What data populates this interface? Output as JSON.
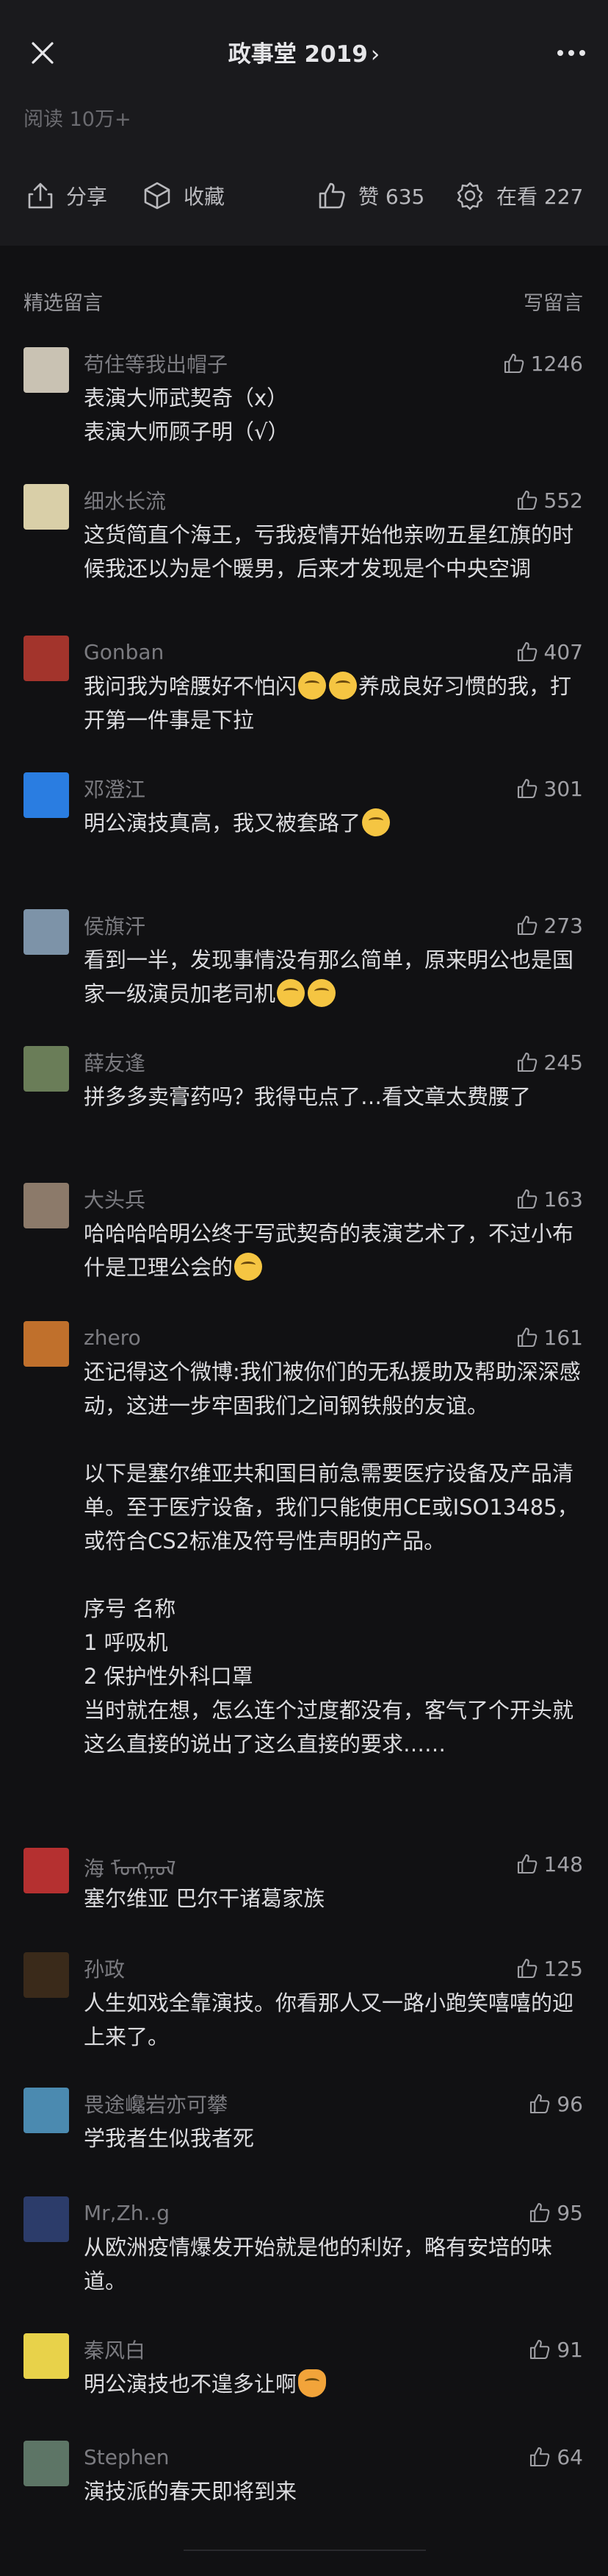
{
  "nav": {
    "title": "政事堂 2019",
    "chevron": "›"
  },
  "article": {
    "read_count": "阅读 10万+"
  },
  "actions": {
    "share": "分享",
    "favorite": "收藏",
    "like": "赞 635",
    "watching": "在看 227"
  },
  "section": {
    "title": "精选留言",
    "write": "写留言"
  },
  "colors": {
    "background": "#111113",
    "header": "#1a1a1d",
    "nickname": "#7b7b80",
    "text": "#dcdcdf"
  },
  "comments": [
    {
      "nick": "苟住等我出帽子",
      "likes": "1246",
      "text": "表演大师武契奇（x）\n表演大师顾子明（√）",
      "avatar": "#c9c2b3"
    },
    {
      "nick": "细水长流",
      "likes": "552",
      "text": "这货简直个海王，亏我疫情开始他亲吻五星红旗的时候我还以为是个暖男，后来才发现是个中央空调",
      "avatar": "#d9cfa8"
    },
    {
      "nick": "Gonban",
      "likes": "407",
      "text": "我问我为啥腰好不怕闪",
      "text_after": "养成良好习惯的我，打开第一件事是下拉",
      "avatar": "#a3342c"
    },
    {
      "nick": "邓澄江",
      "likes": "301",
      "text": "明公演技真高，我又被套路了",
      "avatar": "#2a7de1"
    },
    {
      "nick": "侯旗汗",
      "likes": "273",
      "text": "看到一半，发现事情没有那么简单，原来明公也是国家一级演员加老司机",
      "avatar": "#7d93a8"
    },
    {
      "nick": "薛友逢",
      "likes": "245",
      "text": "拼多多卖膏药吗？我得屯点了…看文章太费腰了",
      "avatar": "#6a7d58"
    },
    {
      "nick": "大头兵",
      "likes": "163",
      "text": "哈哈哈哈明公终于写武契奇的表演艺术了，不过小布什是卫理公会的",
      "avatar": "#8c7a6a"
    },
    {
      "nick": "zhero",
      "likes": "161",
      "text": "还记得这个微博:我们被你们的无私援助及帮助深深感动，这进一步牢固我们之间钢铁般的友谊。\n\n以下是塞尔维亚共和国目前急需要医疗设备及产品清单。至于医疗设备，我们只能使用CE或ISO13485，或符合CS2标准及符号性声明的产品。\n\n序号 名称\n1 呼吸机\n2 保护性外科口罩\n当时就在想，怎么连个过度都没有，客气了个开头就这么直接的说出了这么直接的要求……",
      "avatar": "#c0702c"
    },
    {
      "nick": "海 ᠮᠣᠩᠭᠣᠯ",
      "likes": "148",
      "text": "塞尔维亚 巴尔干诸葛家族",
      "avatar": "#b53030"
    },
    {
      "nick": "孙政",
      "likes": "125",
      "text": "人生如戏全靠演技。你看那人又一路小跑笑嘻嘻的迎上来了。",
      "avatar": "#3a2a1a"
    },
    {
      "nick": "畏途巉岩亦可攀",
      "likes": "96",
      "text": "学我者生似我者死",
      "avatar": "#4b8ab0"
    },
    {
      "nick": "Mr,Zh..g",
      "likes": "95",
      "text": "从欧洲疫情爆发开始就是他的利好，略有安培的味道。",
      "avatar": "#2c3c6a"
    },
    {
      "nick": "秦风白",
      "likes": "91",
      "text": "明公演技也不遑多让啊",
      "avatar": "#e8d24a"
    },
    {
      "nick": "Stephen",
      "likes": "64",
      "text": "演技派的春天即将到来",
      "avatar": "#5d7566"
    }
  ]
}
